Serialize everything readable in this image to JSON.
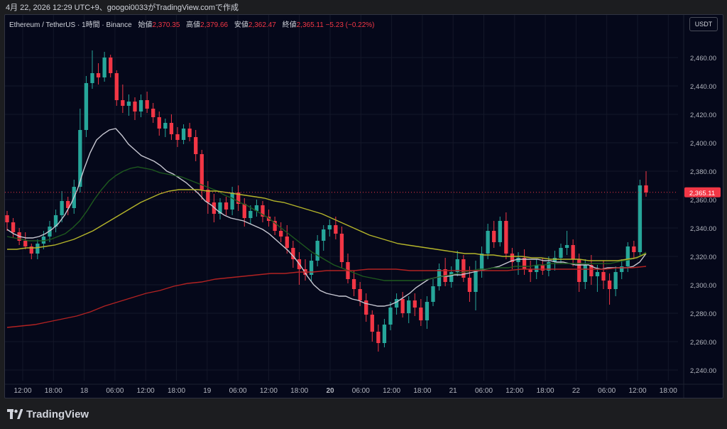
{
  "header": {
    "timestamp_text": "4月 22, 2026 12:29 UTC+9、googoi0033がTradingView.comで作成"
  },
  "legend": {
    "symbol": "Ethereum / TetherUS · 1時間 · Binance",
    "open_label": "始値",
    "open": "2,370.35",
    "high_label": "高値",
    "high": "2,379.66",
    "low_label": "安値",
    "low": "2,362.47",
    "close_label": "終値",
    "close": "2,365.11",
    "change": "−5.23 (−0.22%)"
  },
  "currency_button": "USDT",
  "footer": {
    "brand": "TradingView",
    "logo_icon": "tradingview-logo-icon"
  },
  "colors": {
    "up": "#26a69a",
    "down": "#f23645",
    "background": "#05081a",
    "ma_fast": "#c8c8d2",
    "ma_mid": "#1e5a1e",
    "ma_yellow": "#b5b52a",
    "ma_slow": "#b22222"
  },
  "chart_data": {
    "type": "candlestick",
    "symbol": "ETH/USDT",
    "interval": "1h",
    "ylim": [
      2232,
      2470
    ],
    "y_ticks": [
      2240,
      2260,
      2280,
      2300,
      2320,
      2340,
      2360,
      2380,
      2400,
      2420,
      2440,
      2460
    ],
    "y_tick_labels": [
      "2,240.00",
      "2,260.00",
      "2,280.00",
      "2,300.00",
      "2,320.00",
      "2,340.00",
      "2,360.00",
      "2,380.00",
      "2,400.00",
      "2,420.00",
      "2,440.00",
      "2,460.00"
    ],
    "x_labels": [
      "12:00",
      "18:00",
      "18",
      "06:00",
      "12:00",
      "18:00",
      "19",
      "06:00",
      "12:00",
      "18:00",
      "20",
      "06:00",
      "12:00",
      "18:00",
      "21",
      "06:00",
      "12:00",
      "18:00",
      "22",
      "06:00",
      "12:00",
      "18:00"
    ],
    "x_label_bold": [
      "20"
    ],
    "current_price": 2365.11,
    "current_price_label": "2,365.11",
    "candles": [
      [
        2349,
        2352,
        2338,
        2344
      ],
      [
        2344,
        2347,
        2333,
        2337
      ],
      [
        2337,
        2340,
        2328,
        2331
      ],
      [
        2331,
        2337,
        2325,
        2327
      ],
      [
        2327,
        2329,
        2318,
        2322
      ],
      [
        2322,
        2332,
        2318,
        2329
      ],
      [
        2329,
        2338,
        2325,
        2334
      ],
      [
        2334,
        2345,
        2330,
        2341
      ],
      [
        2341,
        2353,
        2337,
        2349
      ],
      [
        2349,
        2366,
        2344,
        2359
      ],
      [
        2359,
        2362,
        2349,
        2354
      ],
      [
        2354,
        2374,
        2350,
        2369
      ],
      [
        2369,
        2424,
        2365,
        2409
      ],
      [
        2409,
        2447,
        2404,
        2442
      ],
      [
        2442,
        2465,
        2438,
        2449
      ],
      [
        2449,
        2456,
        2441,
        2446
      ],
      [
        2446,
        2464,
        2443,
        2460
      ],
      [
        2460,
        2462,
        2446,
        2449
      ],
      [
        2449,
        2451,
        2426,
        2430
      ],
      [
        2430,
        2441,
        2421,
        2426
      ],
      [
        2426,
        2434,
        2419,
        2429
      ],
      [
        2429,
        2432,
        2416,
        2422
      ],
      [
        2422,
        2434,
        2418,
        2430
      ],
      [
        2430,
        2436,
        2421,
        2424
      ],
      [
        2424,
        2428,
        2414,
        2418
      ],
      [
        2418,
        2422,
        2405,
        2410
      ],
      [
        2410,
        2417,
        2404,
        2414
      ],
      [
        2414,
        2420,
        2402,
        2406
      ],
      [
        2406,
        2411,
        2397,
        2402
      ],
      [
        2402,
        2413,
        2399,
        2410
      ],
      [
        2410,
        2414,
        2401,
        2404
      ],
      [
        2404,
        2409,
        2387,
        2392
      ],
      [
        2392,
        2395,
        2360,
        2367
      ],
      [
        2367,
        2373,
        2350,
        2358
      ],
      [
        2358,
        2364,
        2344,
        2350
      ],
      [
        2350,
        2361,
        2346,
        2358
      ],
      [
        2358,
        2362,
        2349,
        2353
      ],
      [
        2353,
        2369,
        2349,
        2365
      ],
      [
        2365,
        2370,
        2352,
        2357
      ],
      [
        2357,
        2361,
        2341,
        2347
      ],
      [
        2347,
        2356,
        2343,
        2352
      ],
      [
        2352,
        2360,
        2348,
        2356
      ],
      [
        2356,
        2359,
        2344,
        2348
      ],
      [
        2348,
        2353,
        2341,
        2345
      ],
      [
        2345,
        2348,
        2335,
        2338
      ],
      [
        2338,
        2344,
        2330,
        2334
      ],
      [
        2334,
        2342,
        2322,
        2326
      ],
      [
        2326,
        2331,
        2312,
        2318
      ],
      [
        2318,
        2323,
        2300,
        2311
      ],
      [
        2311,
        2318,
        2303,
        2307
      ],
      [
        2307,
        2322,
        2302,
        2317
      ],
      [
        2317,
        2335,
        2313,
        2331
      ],
      [
        2331,
        2342,
        2324,
        2339
      ],
      [
        2339,
        2346,
        2334,
        2342
      ],
      [
        2342,
        2348,
        2332,
        2336
      ],
      [
        2336,
        2341,
        2312,
        2316
      ],
      [
        2316,
        2322,
        2301,
        2304
      ],
      [
        2304,
        2310,
        2292,
        2297
      ],
      [
        2297,
        2302,
        2285,
        2289
      ],
      [
        2289,
        2294,
        2274,
        2279
      ],
      [
        2279,
        2282,
        2260,
        2267
      ],
      [
        2267,
        2272,
        2253,
        2259
      ],
      [
        2259,
        2276,
        2256,
        2272
      ],
      [
        2272,
        2288,
        2268,
        2284
      ],
      [
        2284,
        2294,
        2279,
        2290
      ],
      [
        2290,
        2295,
        2277,
        2280
      ],
      [
        2280,
        2292,
        2273,
        2289
      ],
      [
        2289,
        2294,
        2278,
        2284
      ],
      [
        2284,
        2290,
        2271,
        2275
      ],
      [
        2275,
        2292,
        2269,
        2288
      ],
      [
        2288,
        2304,
        2285,
        2299
      ],
      [
        2299,
        2315,
        2296,
        2311
      ],
      [
        2311,
        2319,
        2299,
        2302
      ],
      [
        2302,
        2313,
        2298,
        2309
      ],
      [
        2309,
        2324,
        2306,
        2318
      ],
      [
        2318,
        2321,
        2302,
        2305
      ],
      [
        2305,
        2313,
        2288,
        2295
      ],
      [
        2295,
        2317,
        2282,
        2310
      ],
      [
        2310,
        2327,
        2305,
        2322
      ],
      [
        2322,
        2343,
        2318,
        2338
      ],
      [
        2338,
        2345,
        2326,
        2330
      ],
      [
        2330,
        2348,
        2327,
        2345
      ],
      [
        2345,
        2351,
        2318,
        2322
      ],
      [
        2322,
        2326,
        2311,
        2316
      ],
      [
        2316,
        2323,
        2307,
        2319
      ],
      [
        2319,
        2325,
        2307,
        2311
      ],
      [
        2311,
        2317,
        2302,
        2309
      ],
      [
        2309,
        2318,
        2304,
        2314
      ],
      [
        2314,
        2319,
        2307,
        2310
      ],
      [
        2310,
        2320,
        2306,
        2316
      ],
      [
        2316,
        2324,
        2310,
        2319
      ],
      [
        2319,
        2329,
        2315,
        2326
      ],
      [
        2326,
        2338,
        2321,
        2328
      ],
      [
        2328,
        2332,
        2313,
        2318
      ],
      [
        2318,
        2322,
        2295,
        2302
      ],
      [
        2302,
        2318,
        2297,
        2314
      ],
      [
        2314,
        2321,
        2300,
        2306
      ],
      [
        2306,
        2314,
        2295,
        2309
      ],
      [
        2309,
        2317,
        2297,
        2303
      ],
      [
        2303,
        2308,
        2286,
        2297
      ],
      [
        2297,
        2313,
        2292,
        2309
      ],
      [
        2309,
        2318,
        2304,
        2313
      ],
      [
        2313,
        2330,
        2309,
        2327
      ],
      [
        2327,
        2331,
        2318,
        2323
      ],
      [
        2323,
        2374,
        2321,
        2370
      ],
      [
        2370,
        2380,
        2362,
        2365
      ]
    ],
    "moving_averages": [
      {
        "color": "#c8c8d2",
        "values": [
          2339,
          2336,
          2334,
          2333,
          2333,
          2334,
          2336,
          2339,
          2343,
          2349,
          2357,
          2367,
          2381,
          2393,
          2402,
          2406,
          2409,
          2410,
          2405,
          2399,
          2395,
          2391,
          2389,
          2387,
          2384,
          2380,
          2378,
          2375,
          2372,
          2368,
          2364,
          2359,
          2356,
          2352,
          2349,
          2347,
          2346,
          2345,
          2343,
          2341,
          2339,
          2336,
          2332,
          2328,
          2324,
          2319,
          2313,
          2306,
          2300,
          2296,
          2294,
          2293,
          2292,
          2292,
          2290,
          2289,
          2287,
          2286,
          2285,
          2285,
          2286,
          2288,
          2291,
          2294,
          2298,
          2301,
          2304,
          2305,
          2306,
          2306,
          2307,
          2307,
          2308,
          2309,
          2310,
          2311,
          2312,
          2313,
          2315,
          2317,
          2318,
          2318,
          2318,
          2318,
          2317,
          2317,
          2316,
          2316,
          2315,
          2314,
          2314,
          2314,
          2312,
          2311,
          2312,
          2312,
          2312,
          2312,
          2313,
          2316,
          2322
        ]
      },
      {
        "color": "#1e5a1e",
        "values": [
          2334,
          2333,
          2332,
          2331,
          2331,
          2331,
          2332,
          2334,
          2336,
          2340,
          2345,
          2352,
          2360,
          2367,
          2373,
          2377,
          2380,
          2382,
          2383,
          2382,
          2381,
          2379,
          2378,
          2377,
          2376,
          2374,
          2372,
          2370,
          2368,
          2366,
          2363,
          2361,
          2358,
          2356,
          2353,
          2350,
          2347,
          2343,
          2339,
          2335,
          2331,
          2327,
          2323,
          2320,
          2317,
          2314,
          2312,
          2310,
          2308,
          2306,
          2305,
          2304,
          2303,
          2303,
          2303,
          2303,
          2303,
          2303,
          2304,
          2305,
          2306,
          2307,
          2308,
          2309,
          2310,
          2311,
          2311,
          2312,
          2312,
          2312,
          2313,
          2313,
          2313,
          2314,
          2314,
          2315,
          2315,
          2315,
          2315,
          2315,
          2315,
          2315,
          2315,
          2315,
          2316,
          2317,
          2318,
          2320,
          2323
        ]
      },
      {
        "color": "#b5b52a",
        "values": [
          2325,
          2325,
          2326,
          2326,
          2327,
          2328,
          2330,
          2332,
          2335,
          2338,
          2342,
          2346,
          2350,
          2354,
          2358,
          2361,
          2364,
          2366,
          2367,
          2367,
          2367,
          2366,
          2366,
          2365,
          2364,
          2363,
          2362,
          2361,
          2359,
          2358,
          2356,
          2354,
          2352,
          2350,
          2347,
          2344,
          2341,
          2338,
          2335,
          2333,
          2331,
          2329,
          2328,
          2327,
          2326,
          2325,
          2324,
          2323,
          2322,
          2322,
          2321,
          2321,
          2320,
          2320,
          2320,
          2319,
          2319,
          2318,
          2318,
          2318,
          2318,
          2317,
          2317,
          2317,
          2317,
          2318,
          2319,
          2322
        ]
      },
      {
        "color": "#b22222",
        "values": [
          2270,
          2271,
          2272,
          2274,
          2276,
          2278,
          2281,
          2285,
          2288,
          2291,
          2294,
          2296,
          2299,
          2301,
          2302,
          2304,
          2305,
          2306,
          2307,
          2308,
          2308,
          2309,
          2309,
          2310,
          2310,
          2310,
          2311,
          2311,
          2311,
          2310,
          2310,
          2310,
          2310,
          2310,
          2310,
          2310,
          2310,
          2311,
          2311,
          2311,
          2311,
          2311,
          2311,
          2311,
          2312,
          2312,
          2313
        ]
      }
    ]
  }
}
